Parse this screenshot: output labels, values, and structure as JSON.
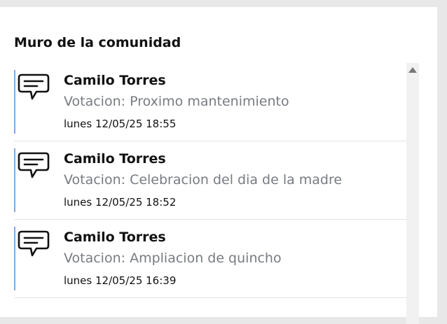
{
  "panel": {
    "title": "Muro de la comunidad"
  },
  "posts": [
    {
      "icon": "message-icon",
      "author": "Camilo Torres",
      "subject": "Votacion: Proximo mantenimiento",
      "datetime": "lunes 12/05/25 18:55"
    },
    {
      "icon": "message-icon",
      "author": "Camilo Torres",
      "subject": "Votacion: Celebracion del dia de la madre",
      "datetime": "lunes 12/05/25 18:52"
    },
    {
      "icon": "message-icon",
      "author": "Camilo Torres",
      "subject": "Votacion: Ampliacion de quincho",
      "datetime": "lunes 12/05/25 16:39"
    }
  ],
  "colors": {
    "accent_bar": "#7fa8dd",
    "subject_text": "#777c82"
  }
}
